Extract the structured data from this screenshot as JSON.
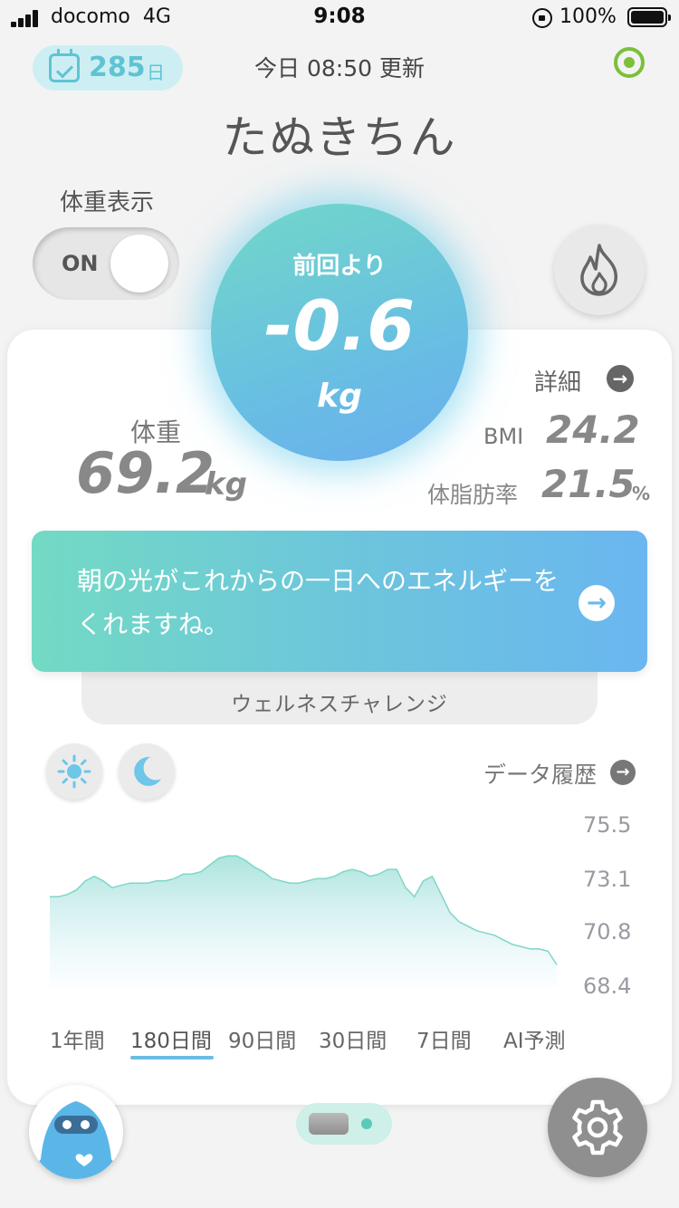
{
  "status_bar": {
    "carrier": "docomo",
    "network": "4G",
    "time": "9:08",
    "battery": "100%"
  },
  "header": {
    "days_count": "285",
    "days_unit": "日",
    "updated": "今日 08:50 更新",
    "user_name": "たぬきちん"
  },
  "toggle": {
    "label": "体重表示",
    "state": "ON"
  },
  "delta": {
    "label": "前回より",
    "value": "-0.6",
    "unit": "kg"
  },
  "stats": {
    "detail_label": "詳細",
    "weight_label": "体重",
    "weight_value": "69.2",
    "weight_unit": "kg",
    "bmi_label": "BMI",
    "bmi_value": "24.2",
    "fat_label": "体脂肪率",
    "fat_value": "21.5",
    "fat_unit": "%"
  },
  "message": {
    "text": "朝の光がこれからの一日へのエネルギーをくれますね。",
    "wellness_label": "ウェルネスチャレンジ"
  },
  "history": {
    "label": "データ履歴"
  },
  "chart_data": {
    "type": "area",
    "y_ticks": [
      "75.5",
      "73.1",
      "70.8",
      "68.4"
    ],
    "ylim": [
      68.4,
      75.5
    ],
    "color": "#7fd6c8",
    "values": [
      72.3,
      72.3,
      72.4,
      72.6,
      73.0,
      73.2,
      73.0,
      72.7,
      72.8,
      72.9,
      72.9,
      72.9,
      73.0,
      73.0,
      73.1,
      73.3,
      73.3,
      73.4,
      73.7,
      74.0,
      74.1,
      74.1,
      73.9,
      73.6,
      73.4,
      73.1,
      73.0,
      72.9,
      72.9,
      73.0,
      73.1,
      73.1,
      73.2,
      73.4,
      73.5,
      73.4,
      73.2,
      73.3,
      73.5,
      73.5,
      72.7,
      72.3,
      73.0,
      73.2,
      72.4,
      71.6,
      71.2,
      71.0,
      70.8,
      70.7,
      70.6,
      70.4,
      70.2,
      70.1,
      70.0,
      70.0,
      69.9,
      69.3
    ]
  },
  "range_tabs": [
    "1年間",
    "180日間",
    "90日間",
    "30日間",
    "7日間",
    "AI予測"
  ],
  "range_selected": "180日間",
  "colors": {
    "accent": "#6bbce5",
    "gradient_start": "#73dac4",
    "gradient_end": "#6ab6f0",
    "badge": "#5fc3d4",
    "target": "#7bbf3a"
  }
}
